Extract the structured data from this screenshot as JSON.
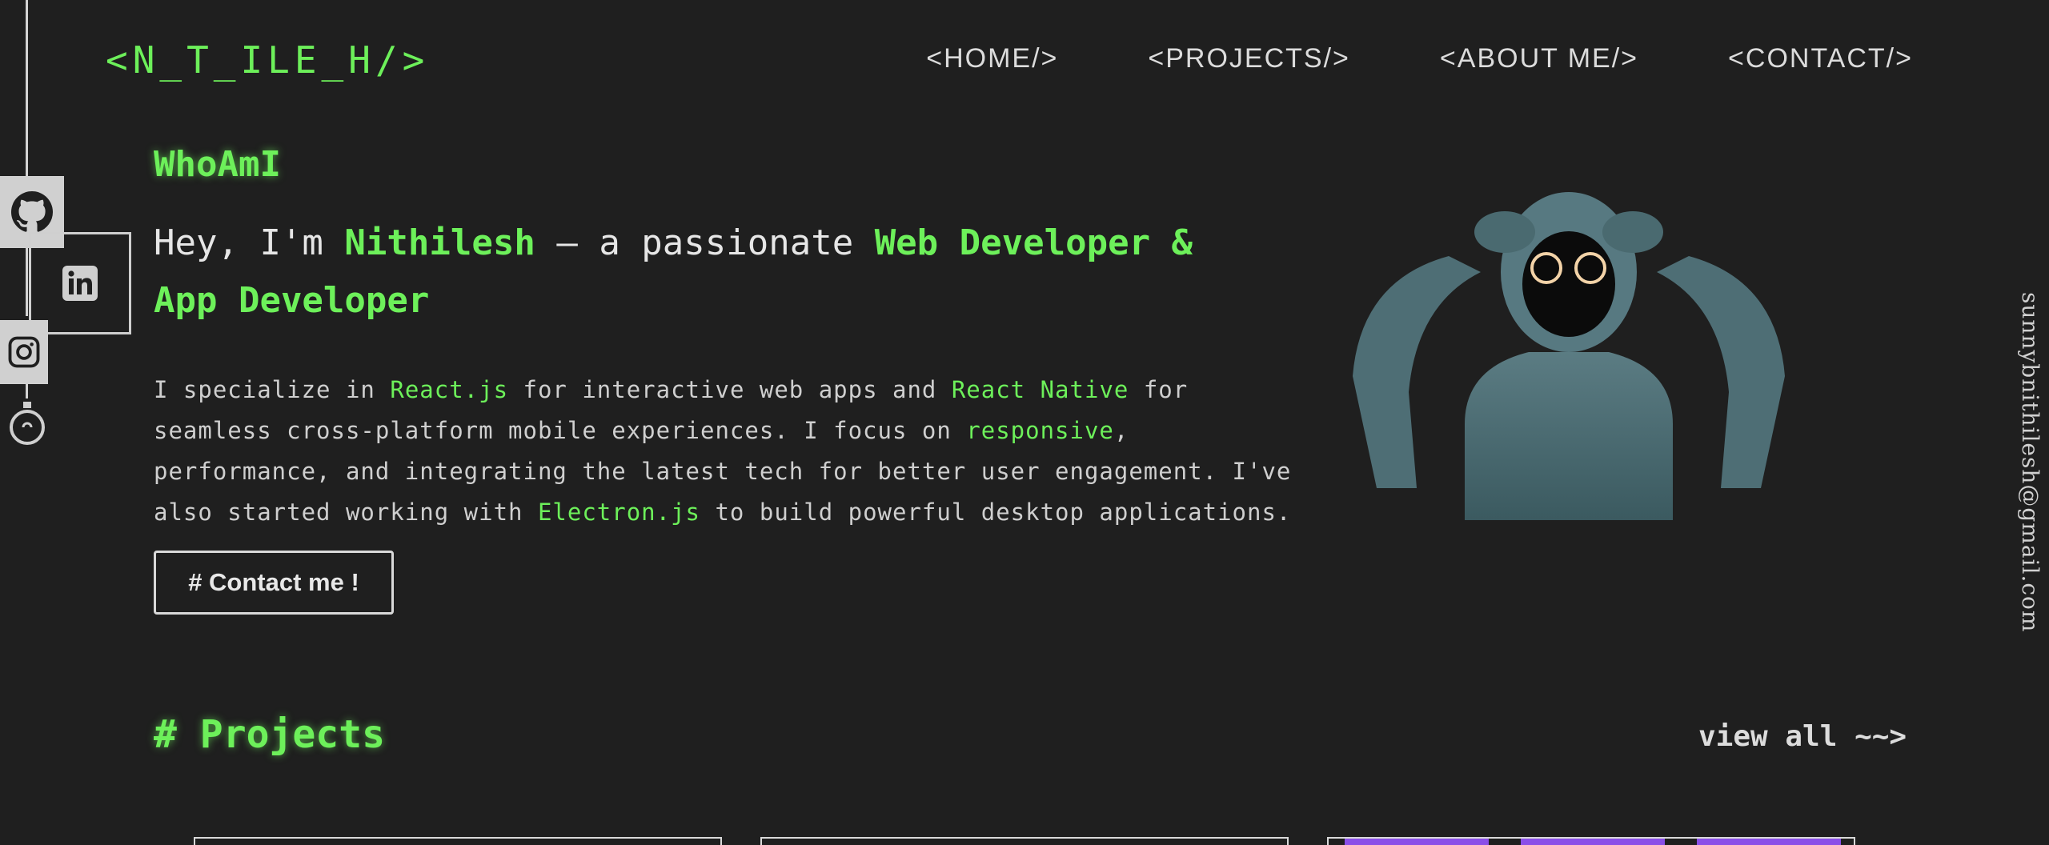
{
  "header": {
    "logo": "<N_T_ILE_H/>",
    "nav": [
      "<HOME/>",
      "<PROJECTS/>",
      "<ABOUT ME/>",
      "<CONTACT/>"
    ]
  },
  "hero": {
    "whoami": "WhoAmI",
    "headline": {
      "prefix": "Hey, I'm ",
      "name": "Nithilesh",
      "middle": " — a passionate ",
      "role": "Web Developer & App Developer"
    },
    "intro": {
      "p1": "I specialize in ",
      "react": "React.js",
      "p2": " for interactive web apps and ",
      "rn": "React Native",
      "p3": " for seamless cross-platform mobile experiences. I focus on ",
      "responsive": "responsive",
      "p4": ", performance, and integrating the latest tech for better user engagement. I've also started working with ",
      "electron": "Electron.js",
      "p5": " to build powerful desktop applications."
    },
    "contact_button": "# Contact me !"
  },
  "email": "sunnybnithilesh@gmail.com",
  "projects": {
    "title": "# Projects",
    "view_all": "view all ~~>"
  },
  "social": [
    "github-icon",
    "linkedin-icon",
    "instagram-icon",
    "bulb-icon"
  ],
  "colors": {
    "accent": "#6df05a",
    "background": "#1f1f1f",
    "text": "#d9d9d9",
    "card_purple": "#8a4fe8"
  }
}
